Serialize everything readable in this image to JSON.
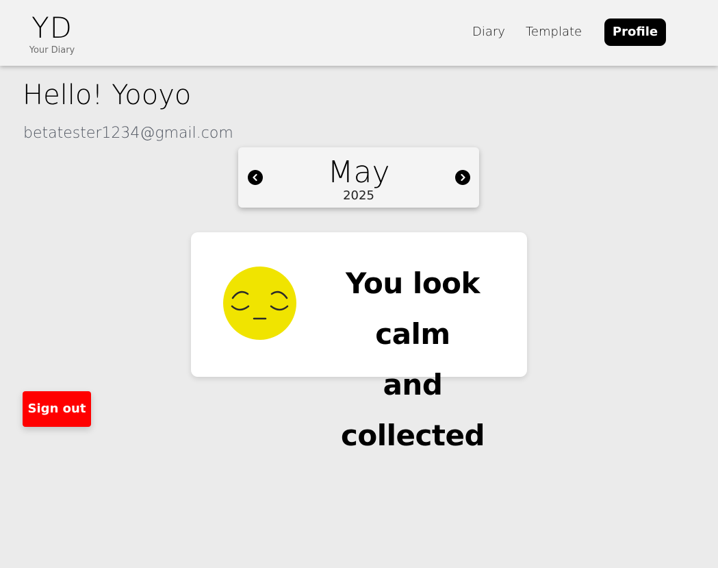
{
  "header": {
    "logo_mark": "YD",
    "logo_subtitle": "Your Diary",
    "nav": {
      "diary": "Diary",
      "template": "Template",
      "profile": "Profile"
    }
  },
  "profile": {
    "greeting": "Hello! Yooyo",
    "email": "betatester1234@gmail.com"
  },
  "month_picker": {
    "month": "May",
    "year": "2025",
    "prev_icon": "chevron-left-icon",
    "next_icon": "chevron-right-icon"
  },
  "mood": {
    "emoji_icon": "relieved-face-icon",
    "line1": "You look calm",
    "line2": "and collected",
    "emoji_color": "#f0e400"
  },
  "actions": {
    "sign_out": "Sign out",
    "sign_out_color": "#ff0000"
  }
}
